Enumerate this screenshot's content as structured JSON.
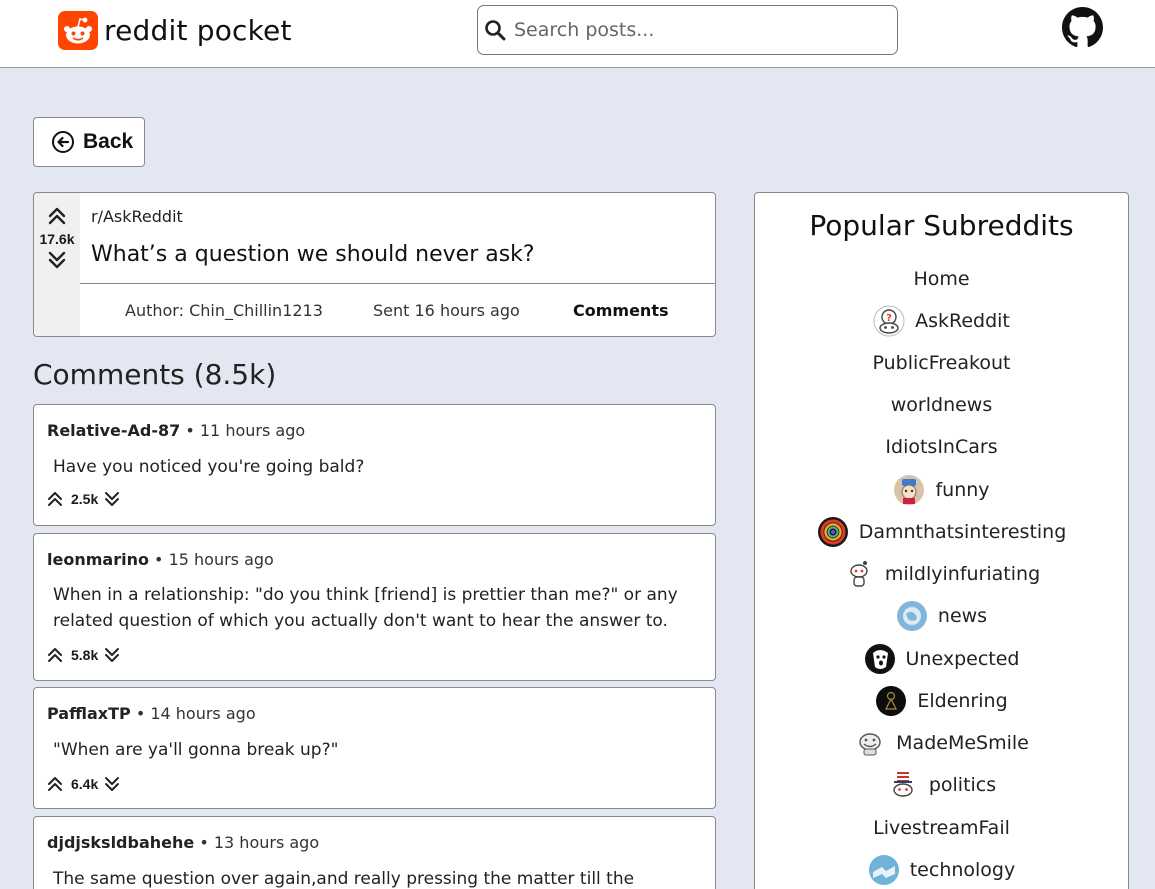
{
  "header": {
    "logo_text": "reddit pocket",
    "search_placeholder": "Search posts..."
  },
  "back_label": "Back",
  "post": {
    "score": "17.6k",
    "subreddit": "r/AskReddit",
    "title": "What’s a question we should never ask?",
    "author": "Author: Chin_Chillin1213",
    "sent": "Sent 16 hours ago",
    "comments_label": "Comments"
  },
  "comments_heading": "Comments (8.5k)",
  "comments": [
    {
      "user": "Relative-Ad-87",
      "time": "• 11 hours ago",
      "body": "Have you noticed you're going bald?",
      "score": "2.5k"
    },
    {
      "user": "leonmarino",
      "time": "• 15 hours ago",
      "body": "When in a relationship: \"do you think [friend] is prettier than me?\" or any related question of which you actually don't want to hear the answer to.",
      "score": "5.8k"
    },
    {
      "user": "PafflaxTP",
      "time": "• 14 hours ago",
      "body": "\"When are ya'll gonna break up?\"",
      "score": "6.4k"
    },
    {
      "user": "djdjsksldbahehe",
      "time": "• 13 hours ago",
      "body": "The same question over again,and really pressing the matter till the",
      "score": ""
    }
  ],
  "sidebar": {
    "title": "Popular Subreddits",
    "items": [
      {
        "label": "Home",
        "icon": "none"
      },
      {
        "label": "AskReddit",
        "icon": "askreddit-icon"
      },
      {
        "label": "PublicFreakout",
        "icon": "none"
      },
      {
        "label": "worldnews",
        "icon": "none"
      },
      {
        "label": "IdiotsInCars",
        "icon": "none"
      },
      {
        "label": "funny",
        "icon": "funny-icon"
      },
      {
        "label": "Damnthatsinteresting",
        "icon": "damnthatsinteresting-icon"
      },
      {
        "label": "mildlyinfuriating",
        "icon": "mildlyinfuriating-icon"
      },
      {
        "label": "news",
        "icon": "news-icon"
      },
      {
        "label": "Unexpected",
        "icon": "unexpected-icon"
      },
      {
        "label": "Eldenring",
        "icon": "eldenring-icon"
      },
      {
        "label": "MadeMeSmile",
        "icon": "mademesmile-icon"
      },
      {
        "label": "politics",
        "icon": "politics-icon"
      },
      {
        "label": "LivestreamFail",
        "icon": "none"
      },
      {
        "label": "technology",
        "icon": "technology-icon"
      }
    ]
  },
  "colors": {
    "page_bg": "#e3e7f1",
    "brand": "#ff4500"
  }
}
